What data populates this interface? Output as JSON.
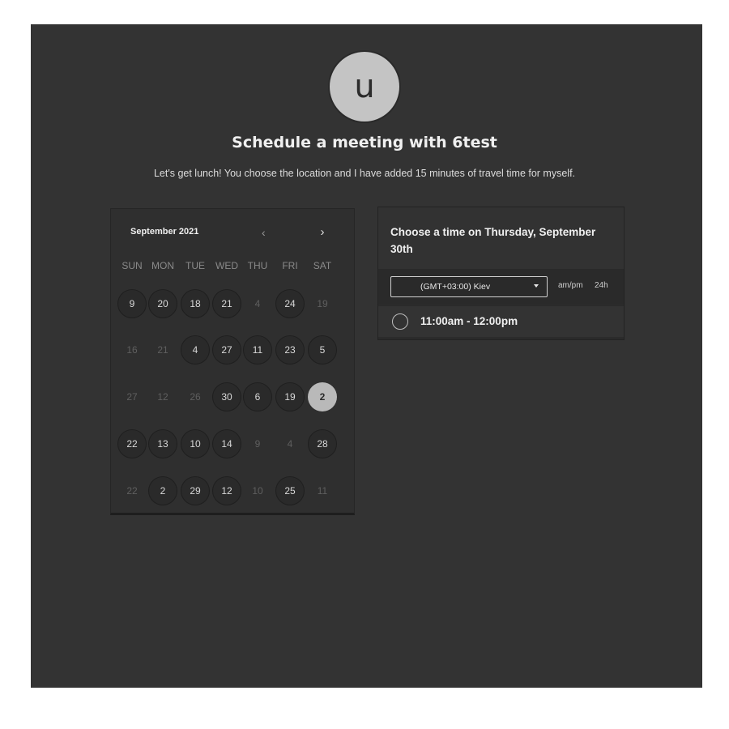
{
  "avatar": {
    "initial": "u"
  },
  "header": {
    "title": "Schedule a meeting with 6test",
    "subtitle": "Let's get lunch! You choose the location and I have added 15 minutes of travel time for myself."
  },
  "calendar": {
    "month_label": "September 2021",
    "prev_icon": "‹",
    "next_icon": "›",
    "weekdays": [
      "SUN",
      "MON",
      "TUE",
      "WED",
      "THU",
      "FRI",
      "SAT"
    ],
    "weeks": [
      [
        {
          "label": "9",
          "state": "avail"
        },
        {
          "label": "20",
          "state": "avail"
        },
        {
          "label": "18",
          "state": "avail"
        },
        {
          "label": "21",
          "state": "avail"
        },
        {
          "label": "4",
          "state": "dim"
        },
        {
          "label": "24",
          "state": "avail"
        },
        {
          "label": "19",
          "state": "dim"
        }
      ],
      [
        {
          "label": "16",
          "state": "dim"
        },
        {
          "label": "21",
          "state": "dim"
        },
        {
          "label": "4",
          "state": "avail"
        },
        {
          "label": "27",
          "state": "avail"
        },
        {
          "label": "11",
          "state": "avail"
        },
        {
          "label": "23",
          "state": "avail"
        },
        {
          "label": "5",
          "state": "avail"
        }
      ],
      [
        {
          "label": "27",
          "state": "dim"
        },
        {
          "label": "12",
          "state": "dim"
        },
        {
          "label": "26",
          "state": "dim"
        },
        {
          "label": "30",
          "state": "avail"
        },
        {
          "label": "6",
          "state": "avail"
        },
        {
          "label": "19",
          "state": "avail"
        },
        {
          "label": "2",
          "state": "selected"
        }
      ],
      [
        {
          "label": "22",
          "state": "avail"
        },
        {
          "label": "13",
          "state": "avail"
        },
        {
          "label": "10",
          "state": "avail"
        },
        {
          "label": "14",
          "state": "avail"
        },
        {
          "label": "9",
          "state": "dim"
        },
        {
          "label": "4",
          "state": "dim"
        },
        {
          "label": "28",
          "state": "avail"
        }
      ],
      [
        {
          "label": "22",
          "state": "dim"
        },
        {
          "label": "2",
          "state": "avail"
        },
        {
          "label": "29",
          "state": "avail"
        },
        {
          "label": "12",
          "state": "avail"
        },
        {
          "label": "10",
          "state": "dim"
        },
        {
          "label": "25",
          "state": "avail"
        },
        {
          "label": "11",
          "state": "dim"
        }
      ]
    ]
  },
  "times": {
    "heading": "Choose a time on Thursday, September 30th",
    "timezone": "(GMT+03:00) Kiev",
    "format_ampm": "am/pm",
    "format_24h": "24h",
    "slots": [
      {
        "label": "11:00am - 12:00pm"
      }
    ]
  }
}
